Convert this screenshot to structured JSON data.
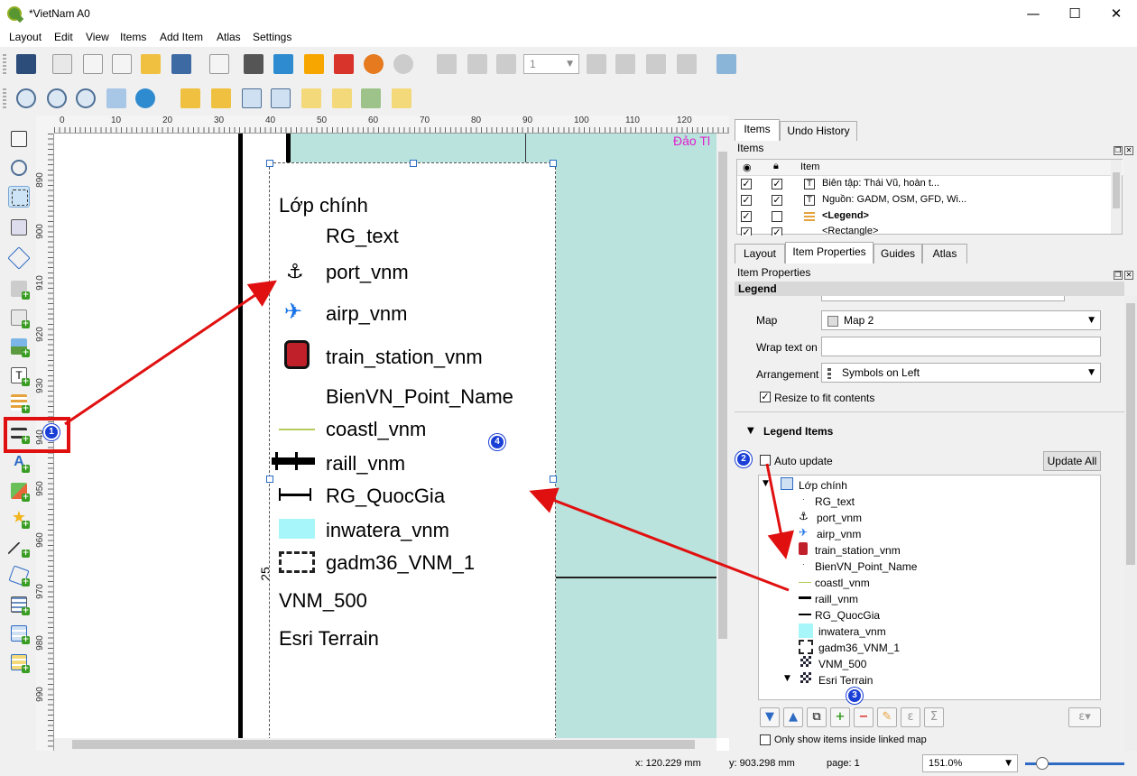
{
  "window": {
    "title": "*VietNam A0",
    "minimize": "—",
    "maximize": "☐",
    "close": "✕"
  },
  "menu": [
    "Layout",
    "Edit",
    "View",
    "Items",
    "Add Item",
    "Atlas",
    "Settings"
  ],
  "toolbar": {
    "page_number": "1"
  },
  "ruler": {
    "top": [
      "0",
      "10",
      "20",
      "30",
      "40",
      "50",
      "60",
      "70",
      "80",
      "90",
      "100",
      "110",
      "120"
    ],
    "left": [
      "890",
      "900",
      "910",
      "920",
      "930",
      "940",
      "950",
      "960",
      "970",
      "980",
      "990"
    ]
  },
  "canvas": {
    "map_label": "Đảo Tl",
    "side_text": "25",
    "legend": {
      "header": "Lớp chính",
      "items": [
        "RG_text",
        "port_vnm",
        "airp_vnm",
        "train_station_vnm",
        "BienVN_Point_Name",
        "coastl_vnm",
        "raill_vnm",
        "RG_QuocGia",
        "inwatera_vnm",
        "gadm36_VNM_1"
      ],
      "extra": [
        "VNM_500",
        "Esri Terrain"
      ]
    }
  },
  "panel": {
    "top_tabs": [
      "Items",
      "Undo History"
    ],
    "items_title": "Items",
    "items_header": {
      "item": "Item"
    },
    "items_rows": [
      {
        "label": "Biên tập: Thái Vũ, hoàn t...",
        "visible": "✓",
        "locked": "✓"
      },
      {
        "label": "Nguồn: GADM, OSM, GFD, Wi...",
        "visible": "✓",
        "locked": "✓"
      },
      {
        "label": "<Legend>",
        "visible": "✓",
        "locked": ""
      },
      {
        "label": "<Rectangle>",
        "visible": "✓",
        "locked": "✓"
      }
    ],
    "bottom_tabs": [
      "Layout",
      "Item Properties",
      "Guides",
      "Atlas"
    ],
    "props_title": "Item Properties",
    "section_title": "Legend",
    "map_label": "Map",
    "map_value": "Map 2",
    "wrap_label": "Wrap text on",
    "arrangement_label": "Arrangement",
    "arrangement_value": "Symbols on Left",
    "resize_label": "Resize to fit contents",
    "legend_items_title": "Legend Items",
    "auto_update_label": "Auto update",
    "update_all_label": "Update All",
    "tree": {
      "group": "Lớp chính",
      "children": [
        "RG_text",
        "port_vnm",
        "airp_vnm",
        "train_station_vnm",
        "BienVN_Point_Name",
        "coastl_vnm",
        "raill_vnm",
        "RG_QuocGia",
        "inwatera_vnm",
        "gadm36_VNM_1",
        "VNM_500",
        "Esri Terrain"
      ]
    },
    "tree_buttons": [
      "▼",
      "▲",
      "⧉",
      "+",
      "−",
      "✎",
      "ε",
      "Σ"
    ],
    "only_show_label": "Only show items inside linked map"
  },
  "status": {
    "x": "x: 120.229 mm",
    "y": "y: 903.298 mm",
    "page": "page: 1",
    "zoom": "151.0%"
  },
  "annotations": {
    "b1": "1",
    "b2": "2",
    "b3": "3",
    "b4": "4"
  },
  "colors": {
    "accent": "#e01010",
    "badge": "#1a3fd6",
    "water": "#b9e3dc",
    "inwatera": "#a6f6fa"
  }
}
